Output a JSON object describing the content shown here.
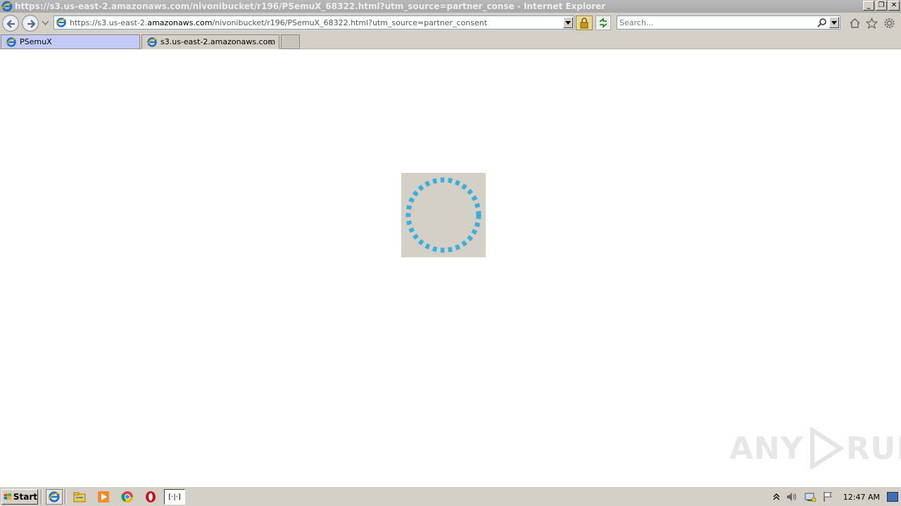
{
  "window": {
    "title": "https://s3.us-east-2.amazonaws.com/nivonibucket/r196/PSemuX_68322.html?utm_source=partner_conse - Internet Explorer",
    "buttons": [
      "0",
      "1",
      "r"
    ]
  },
  "address_bar": {
    "url_prefix": "https://s3.us-east-2.",
    "url_domain": "amazonaws.com",
    "url_suffix": "/nivonibucket/r196/PSemuX_68322.html?utm_source=partner_consent"
  },
  "search": {
    "placeholder": "Search..."
  },
  "tabs": [
    {
      "label": "PSemuX"
    },
    {
      "label": "s3.us-east-2.amazonaws.com",
      "close": "×"
    }
  ],
  "watermark": {
    "left": "ANY",
    "right": "RUN"
  },
  "taskbar": {
    "start_label": "Start",
    "pressed_app_label": "[·|·]",
    "clock": "12:47 AM"
  },
  "colors": {
    "spinner": "#3aafdc",
    "loader_bg": "#d4d0c8",
    "active_tab": "#c3cbf5"
  },
  "icons": [
    "ie-icon",
    "back-icon",
    "forward-icon",
    "lock-icon",
    "refresh-icon",
    "search-icon",
    "home-icon",
    "star-icon",
    "gear-icon",
    "windows-flag-icon",
    "explorer-icon",
    "media-player-icon",
    "chrome-icon",
    "opera-icon",
    "tray-chevron-icon",
    "volume-icon",
    "network-icon",
    "action-center-icon"
  ]
}
